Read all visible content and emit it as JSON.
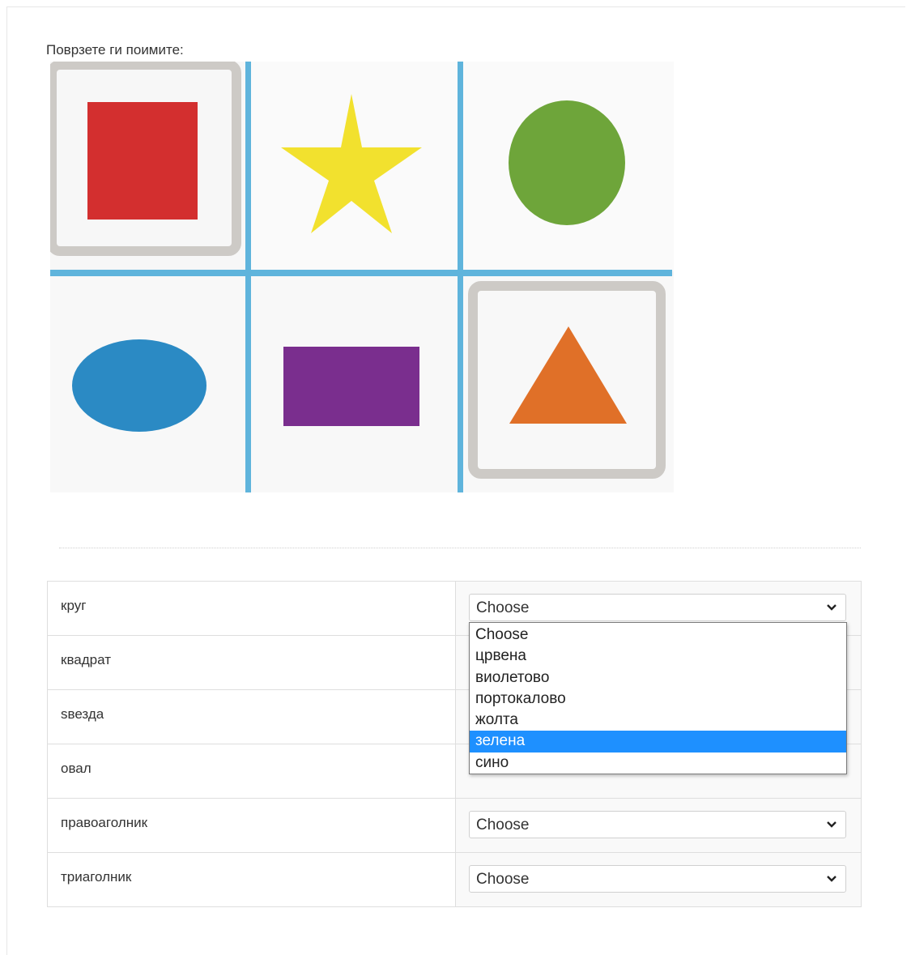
{
  "question": {
    "label": "Поврзете ги поимите:"
  },
  "shapes": {
    "cells": [
      {
        "shape": "square",
        "color": "#d32f2f",
        "framed": true
      },
      {
        "shape": "star",
        "color": "#f2e12e",
        "framed": false
      },
      {
        "shape": "circle",
        "color": "#6ea53a",
        "framed": false
      },
      {
        "shape": "oval",
        "color": "#2b8ac4",
        "framed": false
      },
      {
        "shape": "rectangle",
        "color": "#7a2e8e",
        "framed": false
      },
      {
        "shape": "triangle",
        "color": "#e07028",
        "framed": true
      }
    ],
    "grid_color": "#5fb4dc",
    "frame_color": "#cdcac6"
  },
  "rows": [
    {
      "term": "круг",
      "answer": "Choose"
    },
    {
      "term": "квадрат",
      "answer": ""
    },
    {
      "term": "ѕвезда",
      "answer": ""
    },
    {
      "term": "овал",
      "answer": ""
    },
    {
      "term": "правоаголник",
      "answer": "Choose"
    },
    {
      "term": "триаголник",
      "answer": "Choose"
    }
  ],
  "dropdown": {
    "options": [
      "Choose",
      "црвена",
      "виолетово",
      "портокалово",
      "жолта",
      "зелена",
      "сино"
    ],
    "highlighted": "зелена",
    "highlight_color": "#1e90ff"
  }
}
